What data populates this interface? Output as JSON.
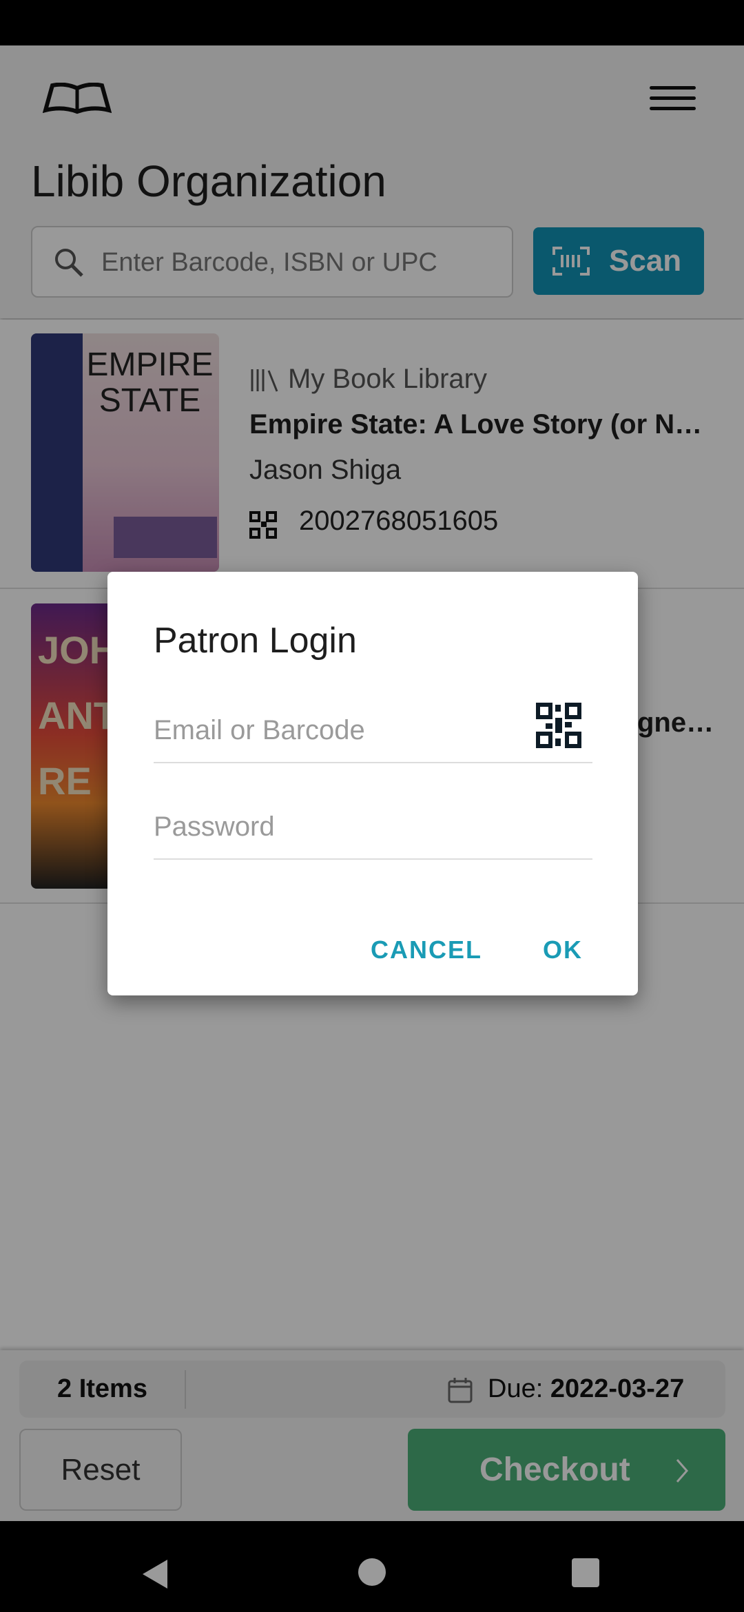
{
  "header": {
    "title": "Libib Organization",
    "search_placeholder": "Enter Barcode, ISBN or UPC",
    "scan_label": "Scan"
  },
  "items": [
    {
      "library": "My Book Library",
      "title": "Empire State: A Love Story (or N…",
      "author": "Jason Shiga",
      "barcode": "2002768051605",
      "cover_text": "EMPIRE STATE"
    },
    {
      "title_fragment": "gne…",
      "cover_text": "JOH G ANTHR RE"
    }
  ],
  "footer": {
    "count": "2 Items",
    "due_label": "Due:",
    "due_date": "2022-03-27",
    "reset": "Reset",
    "checkout": "Checkout"
  },
  "dialog": {
    "title": "Patron Login",
    "email_placeholder": "Email or Barcode",
    "password_placeholder": "Password",
    "cancel": "CANCEL",
    "ok": "OK"
  },
  "colors": {
    "accent": "#1293b6",
    "checkout": "#4caf78"
  }
}
